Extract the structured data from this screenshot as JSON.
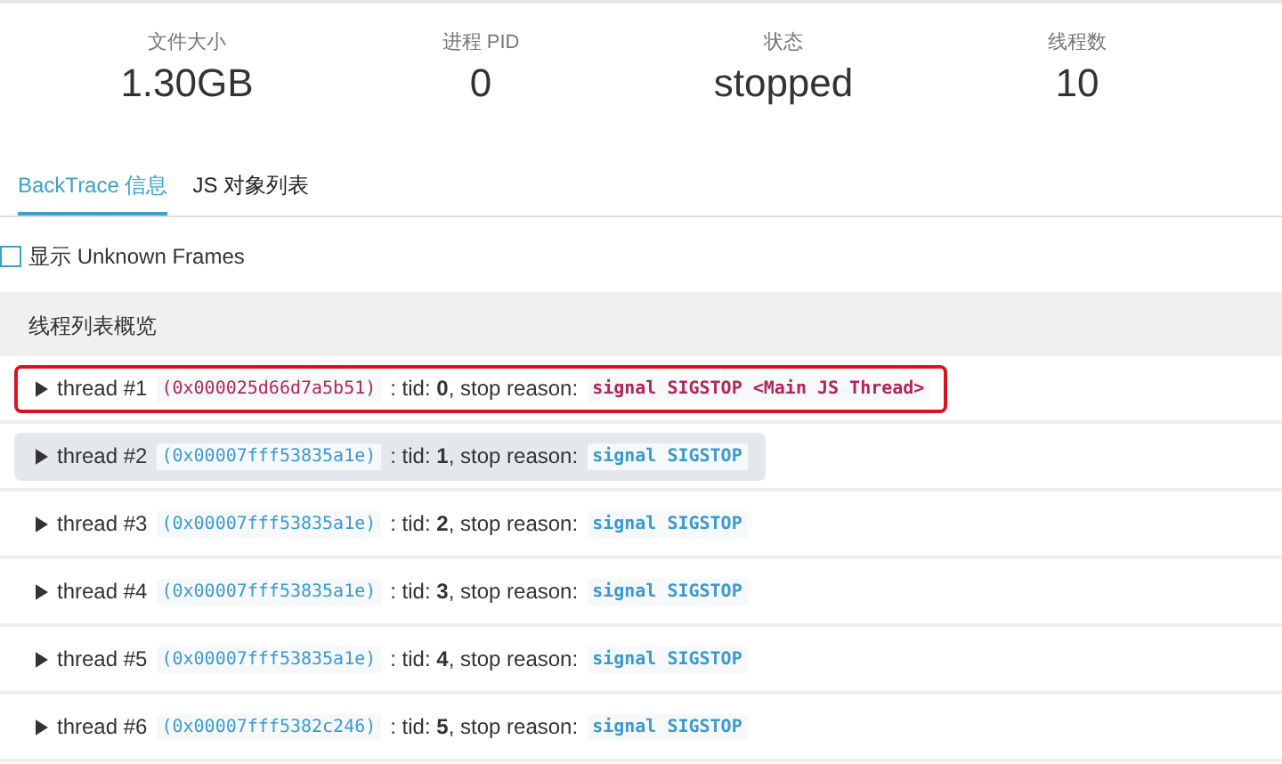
{
  "stats": [
    {
      "label": "文件大小",
      "value": "1.30GB"
    },
    {
      "label": "进程 PID",
      "value": "0"
    },
    {
      "label": "状态",
      "value": "stopped"
    },
    {
      "label": "线程数",
      "value": "10"
    }
  ],
  "tabs": [
    {
      "label": "BackTrace 信息",
      "selected": true
    },
    {
      "label": "JS 对象列表",
      "selected": false
    }
  ],
  "unknown_frames": {
    "label": "显示 Unknown Frames",
    "checked": false
  },
  "thread_list": {
    "title": "线程列表概览",
    "threads": [
      {
        "name": "thread #1",
        "address": "(0x000025d66d7a5b51)",
        "detail": ": tid: **0**, stop reason:",
        "reason": "signal SIGSTOP <Main JS Thread>",
        "highlighted": true,
        "hovered": false
      },
      {
        "name": "thread #2",
        "address": "(0x00007fff53835a1e)",
        "detail": ": tid: **1**, stop reason:",
        "reason": "signal SIGSTOP",
        "highlighted": false,
        "hovered": true
      },
      {
        "name": "thread #3",
        "address": "(0x00007fff53835a1e)",
        "detail": ": tid: **2**, stop reason:",
        "reason": "signal SIGSTOP",
        "highlighted": false,
        "hovered": false
      },
      {
        "name": "thread #4",
        "address": "(0x00007fff53835a1e)",
        "detail": ": tid: **3**, stop reason:",
        "reason": "signal SIGSTOP",
        "highlighted": false,
        "hovered": false
      },
      {
        "name": "thread #5",
        "address": "(0x00007fff53835a1e)",
        "detail": ": tid: **4**, stop reason:",
        "reason": "signal SIGSTOP",
        "highlighted": false,
        "hovered": false
      },
      {
        "name": "thread #6",
        "address": "(0x00007fff5382c246)",
        "detail": ": tid: **5**, stop reason:",
        "reason": "signal SIGSTOP",
        "highlighted": false,
        "hovered": false
      }
    ]
  }
}
